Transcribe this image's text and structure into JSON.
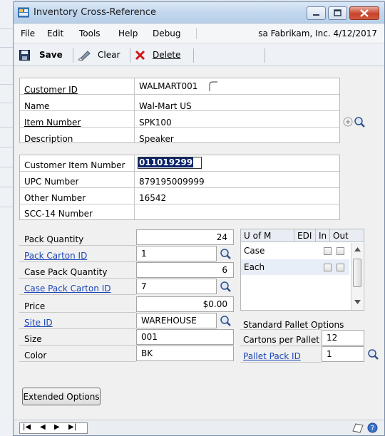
{
  "window": {
    "title": "Inventory Cross-Reference"
  },
  "menu": {
    "items": [
      "File",
      "Edit",
      "Tools",
      "Help",
      "Debug"
    ],
    "info": "sa  Fabrikam, Inc.  4/12/2017"
  },
  "toolbar": {
    "save_label": "Save",
    "clear_label": "Clear",
    "delete_label": "Delete"
  },
  "customer": {
    "id_label": "Customer ID",
    "id_value": "WALMART001",
    "name_label": "Name",
    "name_value": "Wal-Mart US",
    "item_label": "Item Number",
    "item_value": "SPK100",
    "desc_label": "Description",
    "desc_value": "Speaker"
  },
  "numbers": {
    "cust_item_label": "Customer Item Number",
    "cust_item_value": "011019299",
    "upc_label": "UPC Number",
    "upc_value": "879195009999",
    "other_label": "Other Number",
    "other_value": "16542",
    "scc_label": "SCC-14 Number",
    "scc_value": ""
  },
  "pack": {
    "qty_label": "Pack Quantity",
    "qty_value": "24",
    "carton_label": "Pack Carton ID",
    "carton_value": "1",
    "case_qty_label": "Case Pack Quantity",
    "case_qty_value": "6",
    "case_carton_label": "Case Pack Carton ID",
    "case_carton_value": "7"
  },
  "uom_grid": {
    "headers": [
      "U of M",
      "EDI",
      "In",
      "Out"
    ],
    "rows": [
      {
        "uom": "Case"
      },
      {
        "uom": "Each"
      }
    ]
  },
  "details": {
    "price_label": "Price",
    "price_value": "$0.00",
    "site_label": "Site ID",
    "site_value": "WAREHOUSE",
    "size_label": "Size",
    "size_value": "001",
    "color_label": "Color",
    "color_value": "BK"
  },
  "pallet": {
    "heading": "Standard Pallet Options",
    "cartons_label": "Cartons per Pallet",
    "cartons_value": "12",
    "pack_id_label": "Pallet Pack ID",
    "pack_id_value": "1"
  },
  "buttons": {
    "extended_options": "Extended Options"
  },
  "nav": {
    "first": "|◀",
    "prev": "◀",
    "next": "▶",
    "last": "▶|"
  },
  "colors": {
    "link": "#1b46b8",
    "selection": "#0a246a"
  }
}
